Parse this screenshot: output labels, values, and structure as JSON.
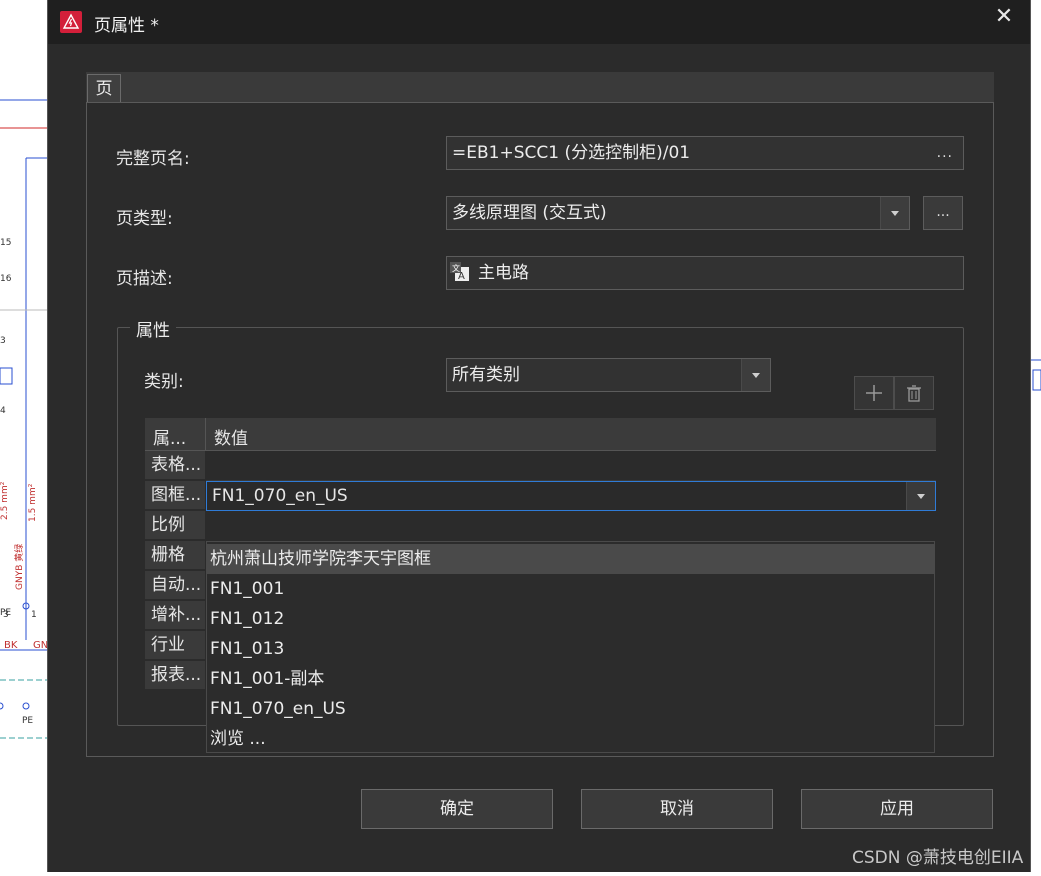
{
  "dialog": {
    "title": "页属性 *",
    "close_glyph": "✕"
  },
  "tab": {
    "label": "页"
  },
  "fields": {
    "full_page_name_label": "完整页名:",
    "full_page_name_value": "=EB1+SCC1 (分选控制柜)/01",
    "page_type_label": "页类型:",
    "page_type_value": "多线原理图 (交互式)",
    "page_desc_label": "页描述:",
    "page_desc_value": "主电路",
    "more_glyph": "..."
  },
  "properties": {
    "group_title": "属性",
    "category_label": "类别:",
    "category_value": "所有类别",
    "add_glyph": "+",
    "grid": {
      "col_name": "属...",
      "col_value": "数值",
      "rows": [
        "表格...",
        "图框...",
        "比例",
        "栅格",
        "自动...",
        "增补...",
        "行业",
        "报表..."
      ],
      "editing_value": "FN1_070_en_US"
    },
    "dropdown_items": [
      "杭州萧山技师学院李天宇图框",
      "FN1_001",
      "FN1_012",
      "FN1_013",
      "FN1_001-副本",
      "FN1_070_en_US",
      "浏览 ..."
    ]
  },
  "buttons": {
    "ok": "确定",
    "cancel": "取消",
    "apply": "应用"
  },
  "watermark": "CSDN @萧技电创EIIA",
  "background": {
    "labels": [
      "15",
      "16",
      "3",
      "4",
      "2.5 mm²",
      "1.5 mm²",
      "GNYB 黄绿",
      "PE",
      "3",
      "1",
      "BK",
      "GN",
      "PE"
    ]
  },
  "colors": {
    "dialog_bg": "#2b2b2b",
    "titlebar_bg": "#1f1f1f",
    "accent_focus": "#2f7bd6",
    "app_icon": "#d31f3a"
  }
}
